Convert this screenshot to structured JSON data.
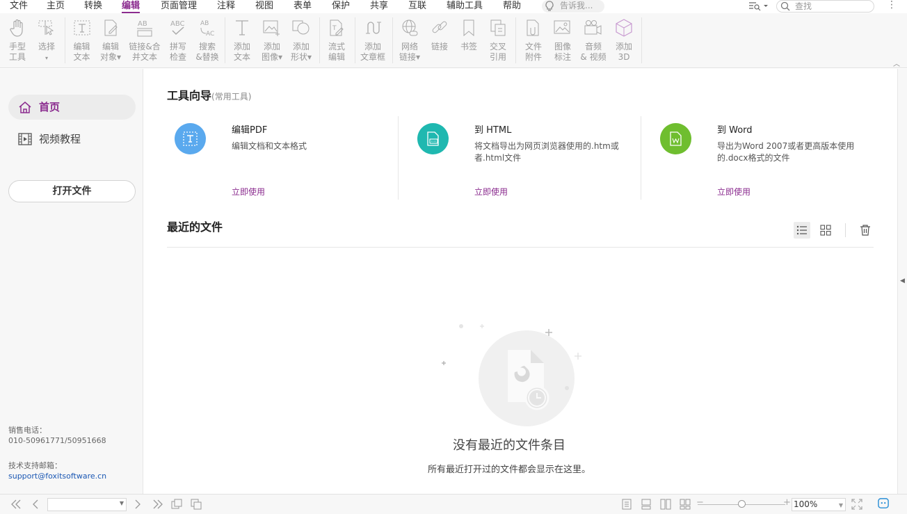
{
  "menubar": {
    "items": [
      "文件",
      "主页",
      "转换",
      "编辑",
      "页面管理",
      "注释",
      "视图",
      "表单",
      "保护",
      "共享",
      "互联",
      "辅助工具",
      "帮助"
    ],
    "active": "编辑",
    "tell_me_placeholder": "告诉我...",
    "search_placeholder": "查找"
  },
  "ribbon": {
    "tools": [
      {
        "line1": "手型",
        "line2": "工具",
        "icon": "hand-icon"
      },
      {
        "line1": "选择",
        "line2": "▾",
        "icon": "select-cursor-icon"
      },
      {
        "line1": "编辑",
        "line2": "文本",
        "icon": "edit-text-icon"
      },
      {
        "line1": "编辑",
        "line2": "对象▾",
        "icon": "edit-object-icon"
      },
      {
        "line1": "链接&合",
        "line2": "并文本",
        "icon": "link-merge-text-icon"
      },
      {
        "line1": "拼写",
        "line2": "检查",
        "icon": "spell-check-icon"
      },
      {
        "line1": "搜索",
        "line2": "&替换",
        "icon": "search-replace-icon"
      },
      {
        "line1": "添加",
        "line2": "文本",
        "icon": "add-text-icon"
      },
      {
        "line1": "添加",
        "line2": "图像▾",
        "icon": "add-image-icon"
      },
      {
        "line1": "添加",
        "line2": "形状▾",
        "icon": "add-shape-icon"
      },
      {
        "line1": "流式",
        "line2": "编辑",
        "icon": "flow-edit-icon"
      },
      {
        "line1": "添加",
        "line2": "文章框",
        "icon": "article-box-icon"
      },
      {
        "line1": "网络",
        "line2": "链接▾",
        "icon": "web-link-icon"
      },
      {
        "line1": "链接",
        "line2": "",
        "icon": "link-icon"
      },
      {
        "line1": "书签",
        "line2": "",
        "icon": "bookmark-icon"
      },
      {
        "line1": "交叉",
        "line2": "引用",
        "icon": "cross-reference-icon"
      },
      {
        "line1": "文件",
        "line2": "附件",
        "icon": "file-attachment-icon"
      },
      {
        "line1": "图像",
        "line2": "标注",
        "icon": "image-annotation-icon"
      },
      {
        "line1": "音频",
        "line2": "& 视频",
        "icon": "audio-video-icon"
      },
      {
        "line1": "添加",
        "line2": "3D",
        "icon": "add-3d-icon"
      }
    ]
  },
  "sidebar": {
    "home_label": "首页",
    "video_label": "视频教程",
    "open_file_label": "打开文件",
    "sales_label": "销售电话：",
    "sales_phone": "010-50961771/50951668",
    "support_label": "技术支持邮箱：",
    "support_email": "support@foxitsoftware.cn"
  },
  "guide": {
    "title": "工具向导",
    "subtitle": "(常用工具)",
    "cards": [
      {
        "title": "编辑PDF",
        "desc": "编辑文档和文本格式",
        "link": "立即使用",
        "color": "#5aa9ee",
        "icon": "edit-pdf-icon"
      },
      {
        "title": "到 HTML",
        "desc": "将文档导出为网页浏览器使用的.htm或者.html文件",
        "link": "立即使用",
        "color": "#1fb8b0",
        "icon": "to-html-icon"
      },
      {
        "title": "到 Word",
        "desc": "导出为Word 2007或者更高版本使用的.docx格式的文件",
        "link": "立即使用",
        "color": "#6fbe2f",
        "icon": "to-word-icon"
      }
    ]
  },
  "recent": {
    "title": "最近的文件",
    "empty_title": "没有最近的文件条目",
    "empty_desc": "所有最近打开过的文件都会显示在这里。"
  },
  "statusbar": {
    "zoom": "100%",
    "zoom_level": 0.5
  }
}
